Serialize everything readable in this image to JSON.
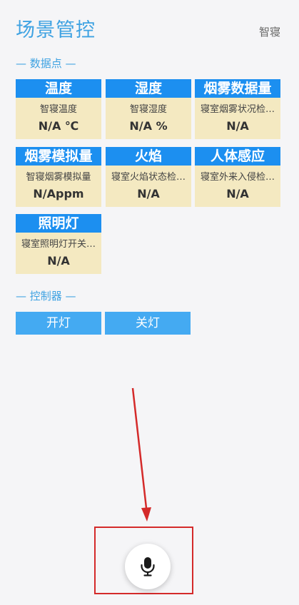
{
  "header": {
    "title": "场景管控",
    "scene_name": "智寝"
  },
  "sections": {
    "data_points": "— 数据点 —",
    "controllers": "— 控制器 —"
  },
  "data_points": [
    {
      "name": "温度",
      "desc": "智寝温度",
      "value": "N/A ℃"
    },
    {
      "name": "湿度",
      "desc": "智寝湿度",
      "value": "N/A %"
    },
    {
      "name": "烟雾数据量",
      "desc": "寝室烟雾状况检…",
      "value": "N/A"
    },
    {
      "name": "烟雾模拟量",
      "desc": "智寝烟雾模拟量",
      "value": "N/Appm"
    },
    {
      "name": "火焰",
      "desc": "寝室火焰状态检…",
      "value": "N/A"
    },
    {
      "name": "人体感应",
      "desc": "寝室外来入侵检…",
      "value": "N/A"
    },
    {
      "name": "照明灯",
      "desc": "寝室照明灯开关…",
      "value": "N/A"
    }
  ],
  "controllers": [
    {
      "label": "开灯"
    },
    {
      "label": "关灯"
    }
  ],
  "voice": {
    "icon": "microphone-icon"
  },
  "colors": {
    "accent": "#3ea2e2",
    "card_header": "#1c8ff0",
    "card_body": "#f4e9c1",
    "button": "#44aaf2",
    "annotation": "#d42a2a"
  }
}
